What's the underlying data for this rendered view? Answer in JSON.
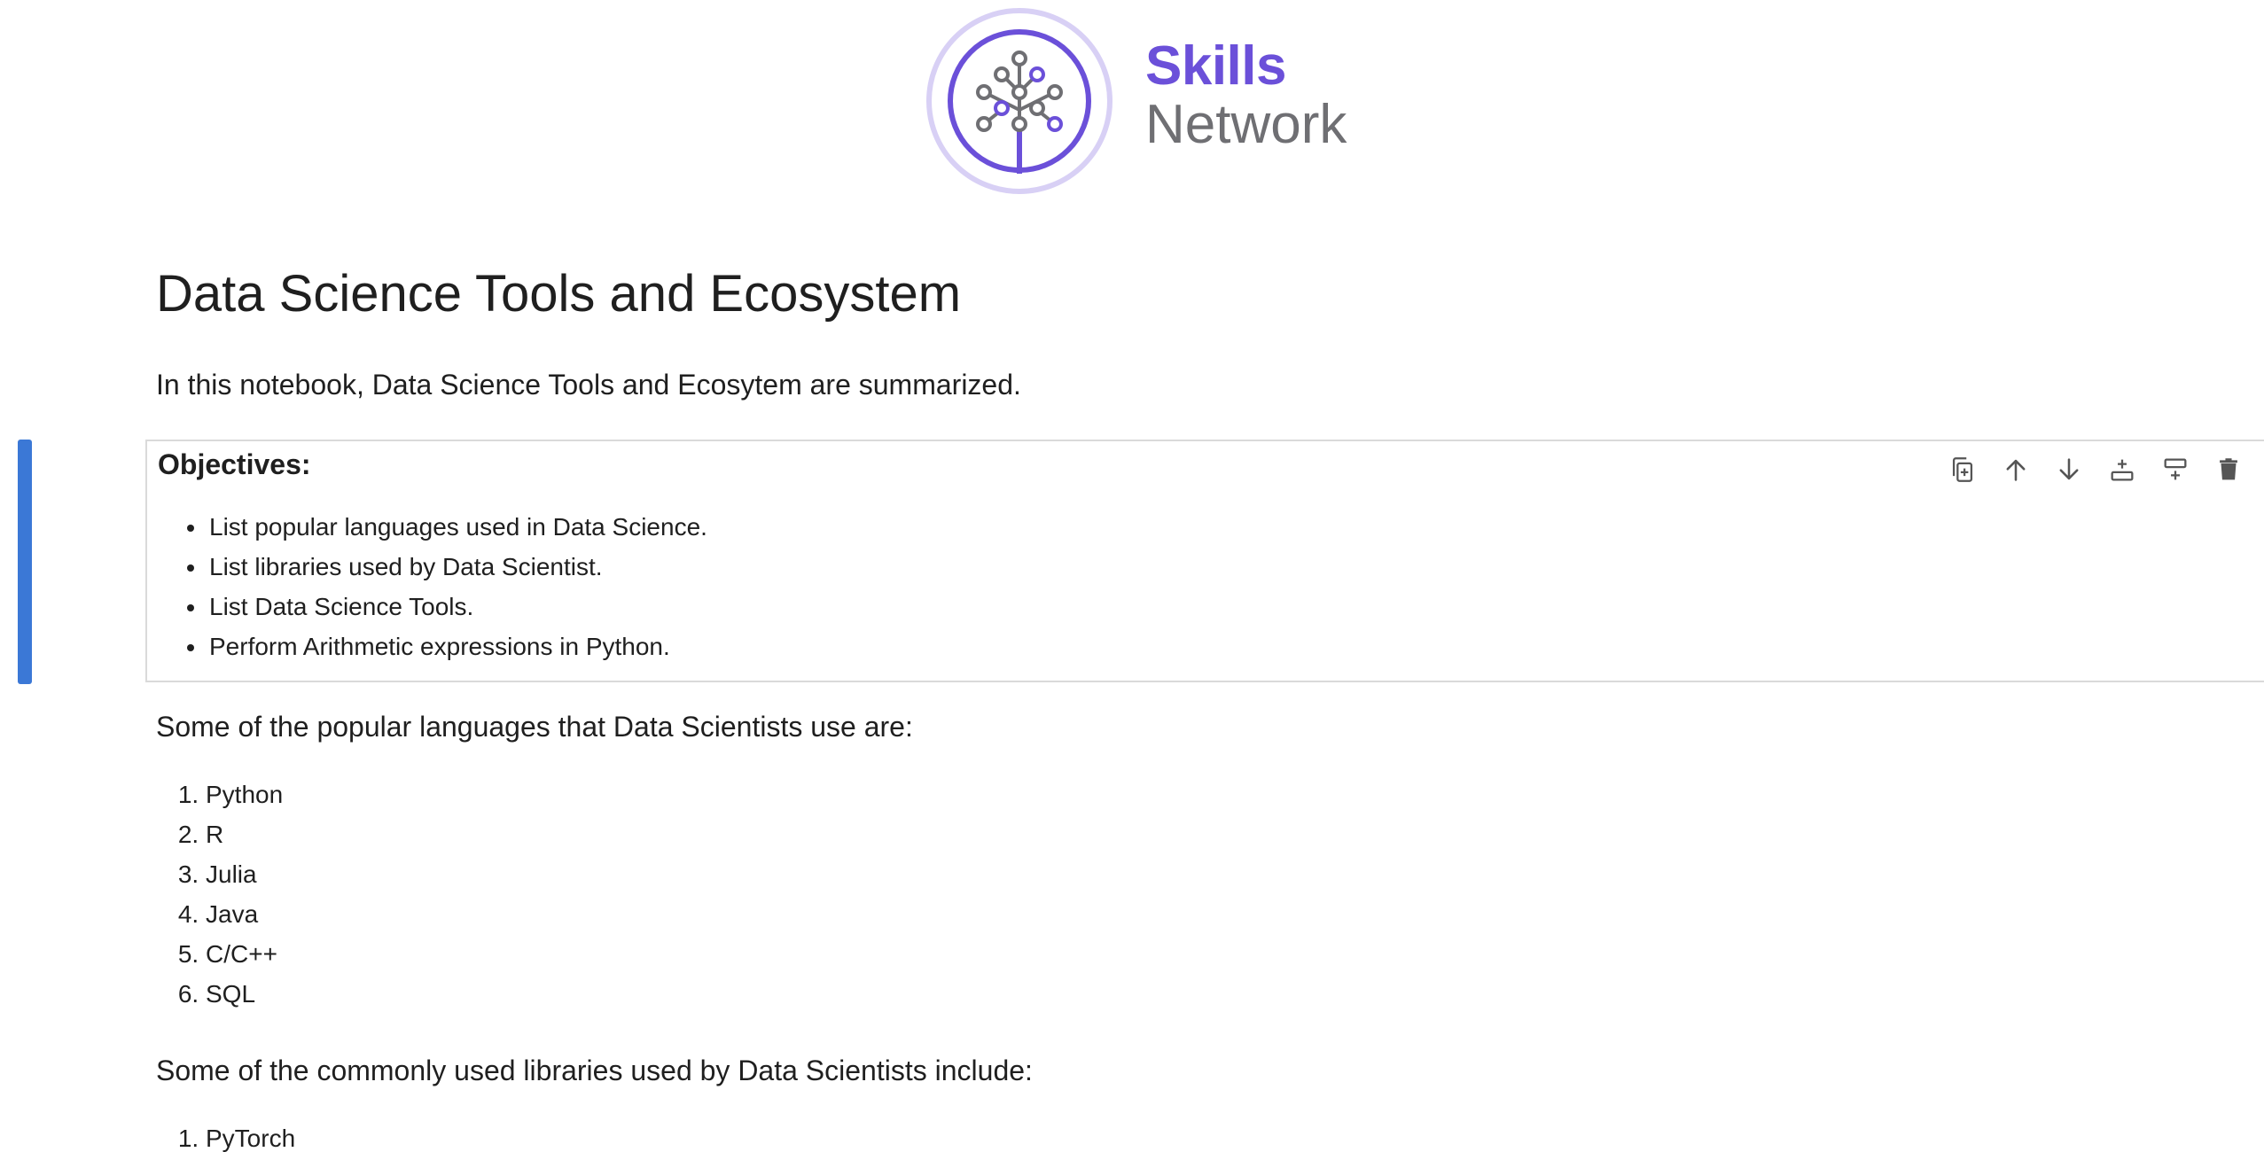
{
  "logo": {
    "line1": "Skills",
    "line2": "Network",
    "colors": {
      "purple": "#6b50d9",
      "light_purple": "#d8d0f5",
      "gray": "#6f6f73"
    }
  },
  "notebook": {
    "title": "Data Science Tools and Ecosystem",
    "intro": "In this notebook, Data Science Tools and Ecosytem are summarized.",
    "objectives_cell": {
      "heading": "Objectives:",
      "items": [
        "List popular languages used in Data Science.",
        "List libraries used by Data Scientist.",
        "List Data Science Tools.",
        "Perform Arithmetic expressions in Python."
      ]
    },
    "languages_intro": "Some of the popular languages that Data Scientists use are:",
    "languages": [
      "Python",
      "R",
      "Julia",
      "Java",
      "C/C++",
      "SQL"
    ],
    "libraries_intro": "Some of the commonly used libraries used by Data Scientists include:",
    "libraries": [
      "PyTorch"
    ]
  },
  "cell_toolbar": {
    "icons": [
      "duplicate-icon",
      "move-up-icon",
      "move-down-icon",
      "insert-above-icon",
      "insert-below-icon",
      "delete-icon"
    ]
  },
  "accent_color": "#3b78d6"
}
